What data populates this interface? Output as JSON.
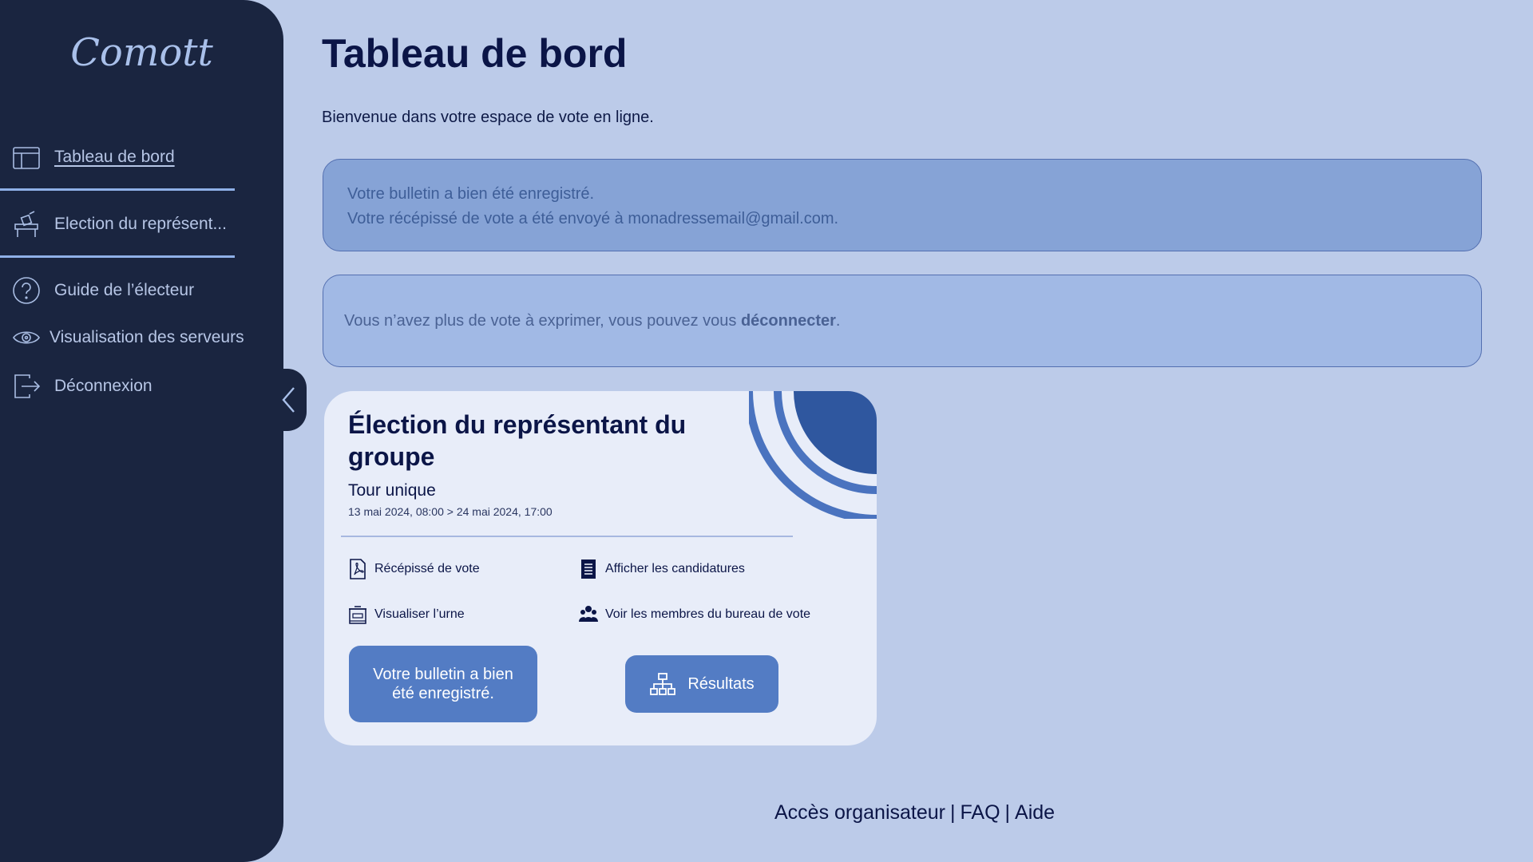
{
  "sidebar": {
    "logo": "Comott",
    "items": [
      {
        "label": "Tableau de bord",
        "icon": "layout-icon"
      },
      {
        "label": "Election du représent...",
        "icon": "ballot-box-icon"
      },
      {
        "label": "Guide de l’électeur",
        "icon": "help-circle-icon"
      },
      {
        "label": "Visualisation des serveurs",
        "icon": "eye-icon"
      },
      {
        "label": "Déconnexion",
        "icon": "logout-icon"
      }
    ]
  },
  "main": {
    "title": "Tableau de bord",
    "subtitle": "Bienvenue dans votre espace de vote en ligne.",
    "alert_success": {
      "line1": "Votre bulletin a bien été enregistré.",
      "line2": "Votre récépissé de vote a été envoyé à monadressemail@gmail.com."
    },
    "alert_info": {
      "text": "Vous n’avez plus de vote à exprimer, vous pouvez vous ",
      "link": "déconnecter",
      "end": "."
    }
  },
  "card": {
    "title": "Élection du représentant du groupe",
    "round": "Tour unique",
    "dates": "13 mai 2024, 08:00 > 24 mai 2024, 17:00",
    "actions": {
      "receipt": "Récépissé de vote",
      "candidates": "Afficher les candidatures",
      "urn": "Visualiser l’urne",
      "members": "Voir les membres du bureau de vote"
    },
    "ballot_button": "Votre bulletin a bien été enregistré.",
    "results_button": "Résultats"
  },
  "footer": {
    "organizer": "Accès organisateur",
    "faq": "FAQ",
    "help": "Aide"
  },
  "colors": {
    "background": "#bccbe9",
    "sidebar": "#1a2540",
    "accent": "#537cc4",
    "success_alert": "#86a3d6",
    "info_alert": "#a1b9e5",
    "card": "#e8edf9"
  }
}
